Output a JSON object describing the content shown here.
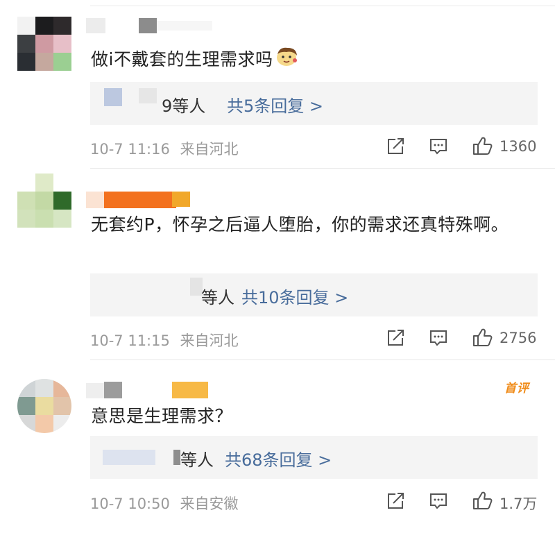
{
  "comments": [
    {
      "text": "做i不戴套的生理需求吗",
      "emoji": "face-emoji",
      "replies_suffix": "9等人",
      "replies_more": "共5条回复 >",
      "time": "10-7 11:16",
      "location": "来自河北",
      "likes": "1360"
    },
    {
      "text": "无套约P，怀孕之后逼人堕胎，你的需求还真特殊啊。",
      "replies_suffix": "等人",
      "replies_more": "共10条回复 >",
      "time": "10-7 11:15",
      "location": "来自河北",
      "likes": "2756"
    },
    {
      "text": "意思是生理需求？",
      "badge": "首评",
      "replies_suffix": "等人",
      "replies_more": "共68条回复 >",
      "time": "10-7 10:50",
      "location": "来自安徽",
      "likes": "1.7万"
    }
  ],
  "icons": {
    "share": "share-icon",
    "comment": "comment-icon",
    "like": "thumbs-up-icon"
  },
  "colors": {
    "link": "#486c9b",
    "badge": "#f08c1a",
    "meta": "#9a9a9a",
    "reply_bg": "#f4f4f4"
  }
}
